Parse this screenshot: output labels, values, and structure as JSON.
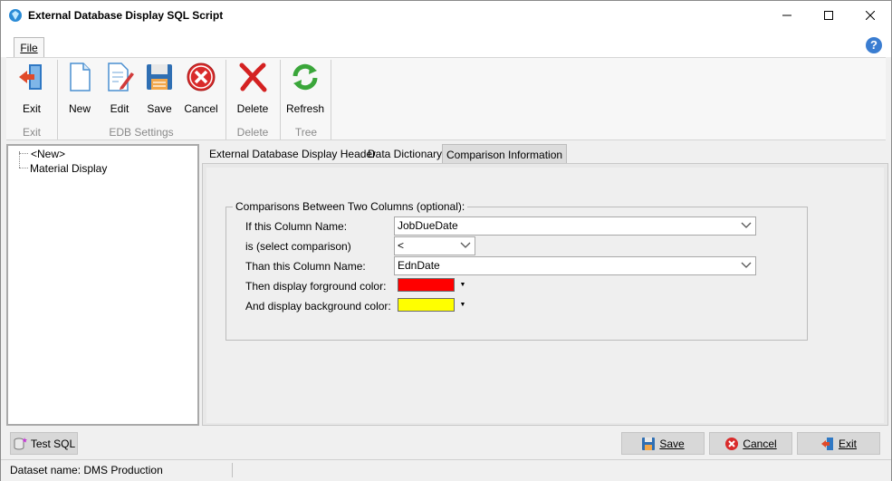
{
  "window": {
    "title": "External Database Display SQL Script"
  },
  "menu": {
    "file_tab": "File"
  },
  "ribbon": {
    "buttons": {
      "exit": "Exit",
      "new": "New",
      "edit": "Edit",
      "save": "Save",
      "cancel": "Cancel",
      "delete": "Delete",
      "refresh": "Refresh"
    },
    "groups": {
      "exit": "Exit",
      "edb_settings": "EDB Settings",
      "delete": "Delete",
      "tree": "Tree"
    }
  },
  "tree": {
    "items": [
      "<New>",
      "Material Display"
    ]
  },
  "tabs": [
    "External Database Display Header",
    "Data Dictionary",
    "Comparison Information"
  ],
  "comparison": {
    "group_title": "Comparisons Between Two Columns (optional):",
    "labels": {
      "column1": "If this Column Name:",
      "comparison": "is (select comparison)",
      "column2": "Than this Column Name:",
      "fg": "Then display forground color:",
      "bg": "And display background color:"
    },
    "values": {
      "column1": "JobDueDate",
      "comparison": "<",
      "column2": "EdnDate"
    },
    "colors": {
      "foreground": "#ff0000",
      "background": "#ffff00"
    }
  },
  "buttons": {
    "test_sql": "Test SQL",
    "save": "Save",
    "cancel": "Cancel",
    "exit": "Exit"
  },
  "status": {
    "dataset": "Dataset name:  DMS Production"
  }
}
